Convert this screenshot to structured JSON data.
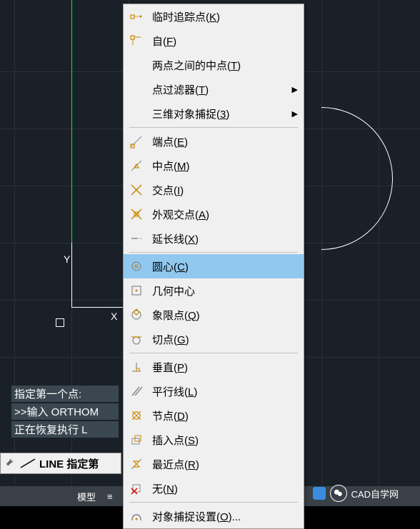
{
  "watermark": "CAD自学网",
  "axis_labels": {
    "x": "X",
    "y": "Y"
  },
  "command_history": [
    "指定第一个点:",
    ">>输入 ORTHOM",
    "正在恢复执行 L"
  ],
  "command_input": "LINE 指定第",
  "status_bar": {
    "model_tab": "模型",
    "layout_icon1": "≡",
    "snap_icon": "⋒"
  },
  "bottom_float": {
    "label": "CAD自学网"
  },
  "menu": {
    "items": [
      {
        "id": "temp-track",
        "label_pre": "临时追踪点(",
        "hotkey": "K",
        "label_post": ")",
        "icon": "temp-track",
        "submenu": false
      },
      {
        "id": "from",
        "label_pre": "自(",
        "hotkey": "F",
        "label_post": ")",
        "icon": "from",
        "submenu": false
      },
      {
        "id": "mid-between",
        "label_pre": "两点之间的中点(",
        "hotkey": "T",
        "label_post": ")",
        "icon": "",
        "submenu": false
      },
      {
        "id": "point-filters",
        "label_pre": "点过滤器(",
        "hotkey": "T",
        "label_post": ")",
        "icon": "",
        "submenu": true
      },
      {
        "id": "3d-osnap",
        "label_pre": "三维对象捕捉(",
        "hotkey": "3",
        "label_post": ")",
        "icon": "",
        "submenu": true
      },
      {
        "sep": true
      },
      {
        "id": "endpoint",
        "label_pre": "端点(",
        "hotkey": "E",
        "label_post": ")",
        "icon": "endpoint",
        "submenu": false
      },
      {
        "id": "midpoint",
        "label_pre": "中点(",
        "hotkey": "M",
        "label_post": ")",
        "icon": "midpoint",
        "submenu": false
      },
      {
        "id": "intersection",
        "label_pre": "交点(",
        "hotkey": "I",
        "label_post": ")",
        "icon": "intersection",
        "submenu": false
      },
      {
        "id": "apparent-int",
        "label_pre": "外观交点(",
        "hotkey": "A",
        "label_post": ")",
        "icon": "apparent",
        "submenu": false
      },
      {
        "id": "extension",
        "label_pre": "延长线(",
        "hotkey": "X",
        "label_post": ")",
        "icon": "extension",
        "submenu": false
      },
      {
        "sep": true
      },
      {
        "id": "center",
        "label_pre": "圆心(",
        "hotkey": "C",
        "label_post": ")",
        "icon": "center",
        "submenu": false,
        "highlighted": true
      },
      {
        "id": "geo-center",
        "label_pre": "几何中心",
        "hotkey": "",
        "label_post": "",
        "icon": "geocenter",
        "submenu": false
      },
      {
        "id": "quadrant",
        "label_pre": "象限点(",
        "hotkey": "Q",
        "label_post": ")",
        "icon": "quadrant",
        "submenu": false
      },
      {
        "id": "tangent",
        "label_pre": "切点(",
        "hotkey": "G",
        "label_post": ")",
        "icon": "tangent",
        "submenu": false
      },
      {
        "sep": true
      },
      {
        "id": "perpendicular",
        "label_pre": "垂直(",
        "hotkey": "P",
        "label_post": ")",
        "icon": "perp",
        "submenu": false
      },
      {
        "id": "parallel",
        "label_pre": "平行线(",
        "hotkey": "L",
        "label_post": ")",
        "icon": "parallel",
        "submenu": false
      },
      {
        "id": "node",
        "label_pre": "节点(",
        "hotkey": "D",
        "label_post": ")",
        "icon": "node",
        "submenu": false
      },
      {
        "id": "insert",
        "label_pre": "插入点(",
        "hotkey": "S",
        "label_post": ")",
        "icon": "insert",
        "submenu": false
      },
      {
        "id": "nearest",
        "label_pre": "最近点(",
        "hotkey": "R",
        "label_post": ")",
        "icon": "nearest",
        "submenu": false
      },
      {
        "id": "none",
        "label_pre": "无(",
        "hotkey": "N",
        "label_post": ")",
        "icon": "none",
        "submenu": false
      },
      {
        "sep": true
      },
      {
        "id": "osnap-settings",
        "label_pre": "对象捕捉设置(",
        "hotkey": "O",
        "label_post": ")...",
        "icon": "settings",
        "submenu": false
      }
    ]
  },
  "colors": {
    "canvas_bg": "#1a2028",
    "grid": "#2a3138",
    "menu_highlight": "#90c8f0",
    "menu_bg": "#f0f0f0"
  }
}
